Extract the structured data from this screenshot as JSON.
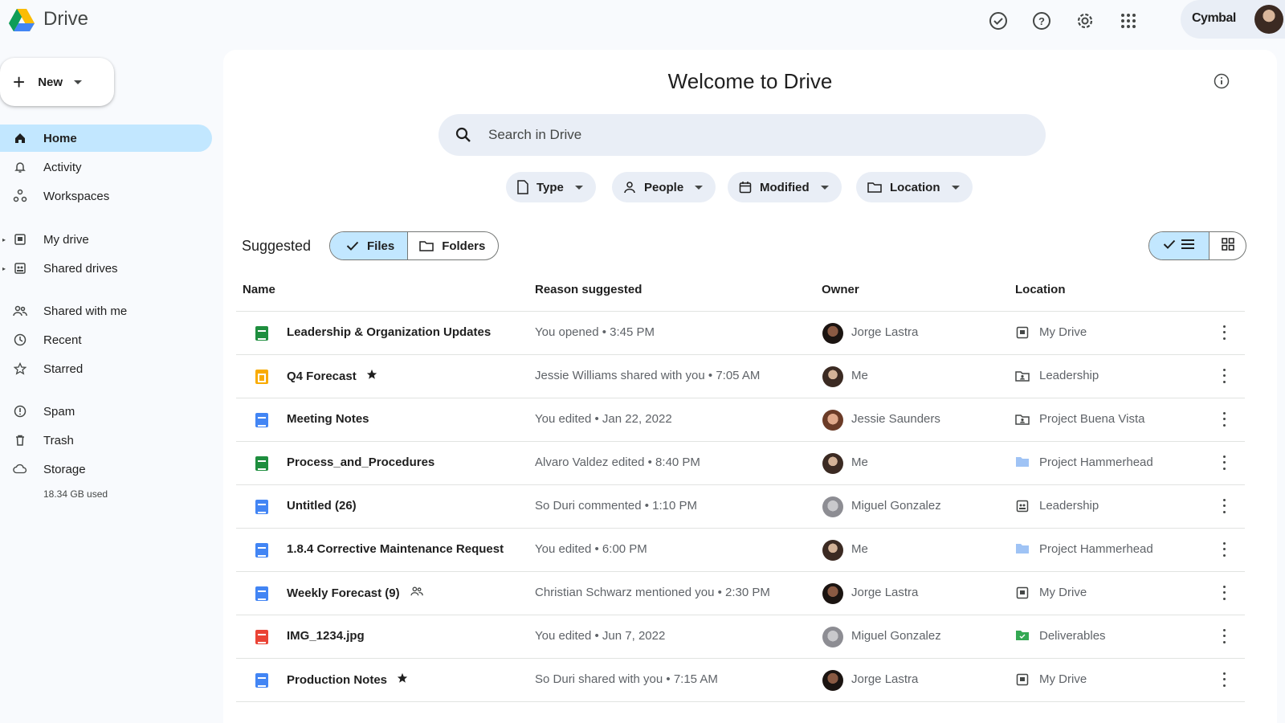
{
  "app": {
    "name": "Drive",
    "org": "Cymbal"
  },
  "topbar": {
    "icons": [
      "status-check-icon",
      "help-icon",
      "settings-icon",
      "apps-grid-icon"
    ]
  },
  "sidebar": {
    "new_label": "New",
    "items": [
      {
        "label": "Home",
        "icon": "home-icon",
        "active": true
      },
      {
        "label": "Activity",
        "icon": "bell-icon"
      },
      {
        "label": "Workspaces",
        "icon": "workspaces-icon"
      },
      {
        "label": "My drive",
        "icon": "my-drive-icon"
      },
      {
        "label": "Shared drives",
        "icon": "shared-drives-icon"
      },
      {
        "label": "Shared with me",
        "icon": "shared-with-me-icon"
      },
      {
        "label": "Recent",
        "icon": "clock-icon"
      },
      {
        "label": "Starred",
        "icon": "star-icon"
      },
      {
        "label": "Spam",
        "icon": "spam-icon"
      },
      {
        "label": "Trash",
        "icon": "trash-icon"
      },
      {
        "label": "Storage",
        "icon": "cloud-icon"
      }
    ],
    "storage_used": "18.34 GB used"
  },
  "main": {
    "title": "Welcome to Drive",
    "search_placeholder": "Search in Drive",
    "filters": [
      "Type",
      "People",
      "Modified",
      "Location"
    ],
    "suggested_label": "Suggested",
    "toggle": {
      "files": "Files",
      "folders": "Folders"
    },
    "columns": {
      "name": "Name",
      "reason": "Reason suggested",
      "owner": "Owner",
      "location": "Location"
    },
    "rows": [
      {
        "name": "Leadership & Organization Updates",
        "type": "sheets",
        "reason": "You opened • 3:45 PM",
        "owner": "Jorge Lastra",
        "avatar": "dark",
        "location": "My Drive",
        "loc_icon": "my-drive"
      },
      {
        "name": "Q4 Forecast",
        "type": "slides",
        "starred": true,
        "reason": "Jessie Williams shared with you • 7:05 AM",
        "owner": "Me",
        "avatar": "me",
        "location": "Leadership",
        "loc_icon": "shared-folder"
      },
      {
        "name": "Meeting Notes",
        "type": "docs",
        "reason": "You edited • Jan 22, 2022",
        "owner": "Jessie Saunders",
        "avatar": "js",
        "location": "Project Buena Vista",
        "loc_icon": "shared-folder"
      },
      {
        "name": "Process_and_Procedures",
        "type": "sheets",
        "reason": "Alvaro Valdez edited • 8:40 PM",
        "owner": "Me",
        "avatar": "me",
        "location": "Project Hammerhead",
        "loc_icon": "folder"
      },
      {
        "name": "Untitled (26)",
        "type": "docs",
        "reason": "So Duri commented • 1:10 PM",
        "owner": "Miguel Gonzalez",
        "avatar": "mg",
        "location": "Leadership",
        "loc_icon": "shared-drive"
      },
      {
        "name": "1.8.4 Corrective Maintenance Request",
        "type": "docs",
        "reason": "You edited • 6:00 PM",
        "owner": "Me",
        "avatar": "me",
        "location": "Project Hammerhead",
        "loc_icon": "folder"
      },
      {
        "name": "Weekly Forecast (9)",
        "type": "docs",
        "shared": true,
        "reason": "Christian Schwarz mentioned you • 2:30 PM",
        "owner": "Jorge Lastra",
        "avatar": "dark",
        "location": "My Drive",
        "loc_icon": "my-drive"
      },
      {
        "name": "IMG_1234.jpg",
        "type": "image",
        "reason": "You edited • Jun 7, 2022",
        "owner": "Miguel Gonzalez",
        "avatar": "mg",
        "location": "Deliverables",
        "loc_icon": "green-folder"
      },
      {
        "name": "Production Notes",
        "type": "docs",
        "starred": true,
        "reason": "So Duri shared with you • 7:15 AM",
        "owner": "Jorge Lastra",
        "avatar": "dark",
        "location": "My Drive",
        "loc_icon": "my-drive"
      }
    ]
  },
  "colors": {
    "accent": "#c2e7ff",
    "chip": "#e9eef6",
    "sheets": "#1e8e3e",
    "slides": "#f9ab00",
    "docs": "#4285f4",
    "image": "#ea4335"
  }
}
